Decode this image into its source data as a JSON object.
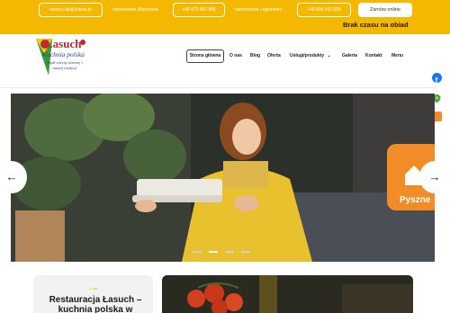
{
  "topbar": {
    "email": "lasuch.vip@interia.pl",
    "warsaw_label": "zamówienia Warszawa",
    "warsaw_phone": "+48 573 882 485",
    "legionowo_label": "zamówienia Legionowo",
    "legionowo_phone": "+48 690 252 659",
    "order_button": "Zamów online",
    "no_time_text": "Brak czasu na obiad",
    "color": "#f5b800"
  },
  "logo": {
    "name": "Łasuch",
    "subtitle": "Kuchnia polska",
    "tagline": "Bądź wierny dawnej i naszej tradycji"
  },
  "nav": {
    "items": [
      {
        "label": "Strona główna",
        "active": true
      },
      {
        "label": "O nas"
      },
      {
        "label": "Blog"
      },
      {
        "label": "Oferta"
      },
      {
        "label": "Usługi/produkty",
        "has_dropdown": true
      },
      {
        "label": "Galeria"
      },
      {
        "label": "Kontakt"
      },
      {
        "label": "Menu"
      }
    ]
  },
  "social": [
    "facebook-icon",
    "google-maps-icon",
    "pyszne-icon"
  ],
  "hero": {
    "prev_label": "←",
    "next_label": "→",
    "badge_text": "Pyszne",
    "slides": 4,
    "active_slide": 1
  },
  "section": {
    "eyebrow": "O nas",
    "title": "Restauracja Łasuch – kuchnia polska w"
  }
}
